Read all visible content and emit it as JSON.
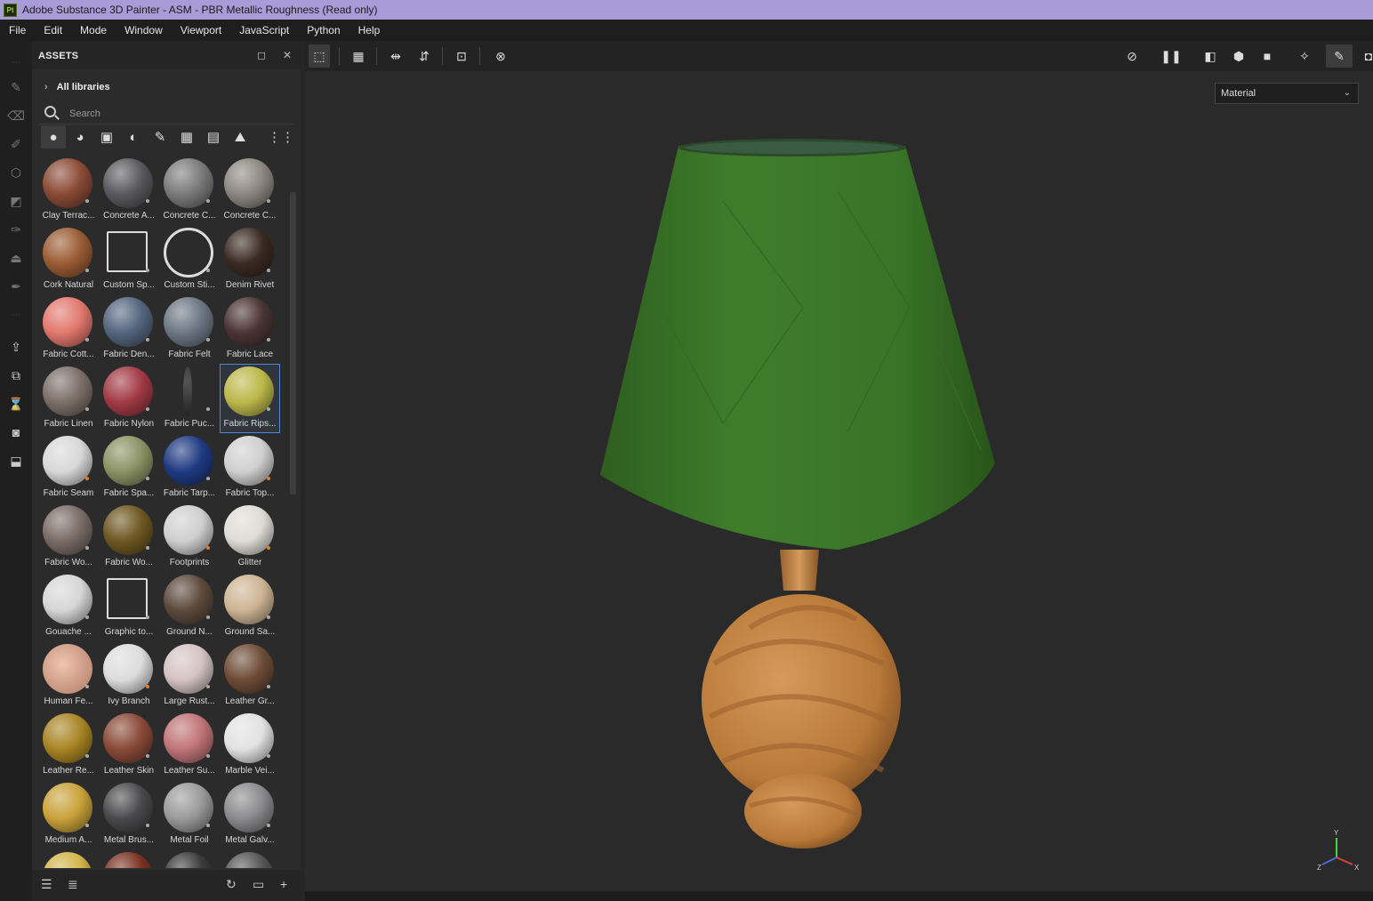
{
  "window": {
    "title": "Adobe Substance 3D Painter - ASM - PBR Metallic Roughness (Read only)",
    "app_icon": "Pt"
  },
  "menu": [
    "File",
    "Edit",
    "Mode",
    "Window",
    "Viewport",
    "JavaScript",
    "Python",
    "Help"
  ],
  "assets": {
    "title": "ASSETS",
    "libraries_label": "All libraries",
    "search_placeholder": "Search",
    "items": [
      {
        "label": "Clay Terrac...",
        "color": "#8a4a36"
      },
      {
        "label": "Concrete A...",
        "color": "#5a5a5e"
      },
      {
        "label": "Concrete C...",
        "color": "#7a7a7a"
      },
      {
        "label": "Concrete C...",
        "color": "#8c8780"
      },
      {
        "label": "Cork Natural",
        "color": "#9a5c34"
      },
      {
        "label": "Custom Sp...",
        "color": "icon"
      },
      {
        "label": "Custom Sti...",
        "color": "icon-face"
      },
      {
        "label": "Denim Rivet",
        "color": "#3a2a22"
      },
      {
        "label": "Fabric Cott...",
        "color": "#e2786e"
      },
      {
        "label": "Fabric Den...",
        "color": "#55657e"
      },
      {
        "label": "Fabric Felt",
        "color": "#6c7784"
      },
      {
        "label": "Fabric Lace",
        "color": "#4a3434"
      },
      {
        "label": "Fabric Linen",
        "color": "#7c6f68"
      },
      {
        "label": "Fabric Nylon",
        "color": "#a23a44"
      },
      {
        "label": "Fabric Puc...",
        "color": "thin"
      },
      {
        "label": "Fabric Rips...",
        "color": "#bcb84a"
      },
      {
        "label": "Fabric Seam",
        "color": "#d8d8d8"
      },
      {
        "label": "Fabric Spa...",
        "color": "#8b9264"
      },
      {
        "label": "Fabric Tarp...",
        "color": "#1f3a82"
      },
      {
        "label": "Fabric Top...",
        "color": "#cfcfcf"
      },
      {
        "label": "Fabric Wo...",
        "color": "#7a6c66"
      },
      {
        "label": "Fabric Wo...",
        "color": "#6e5722"
      },
      {
        "label": "Footprints",
        "color": "#cfcfcf"
      },
      {
        "label": "Glitter",
        "color": "#dedcd6"
      },
      {
        "label": "Gouache ...",
        "color": "#d6d6d6"
      },
      {
        "label": "Graphic to...",
        "color": "icon-graphic"
      },
      {
        "label": "Ground N...",
        "color": "#5c4a3c"
      },
      {
        "label": "Ground Sa...",
        "color": "#cdb494"
      },
      {
        "label": "Human Fe...",
        "color": "face"
      },
      {
        "label": "Ivy Branch",
        "color": "#dcdcdc"
      },
      {
        "label": "Large Rust...",
        "color": "#d5c3c3"
      },
      {
        "label": "Leather Gr...",
        "color": "#6e4c36"
      },
      {
        "label": "Leather Re...",
        "color": "#a88424"
      },
      {
        "label": "Leather Skin",
        "color": "#8a4a38"
      },
      {
        "label": "Leather Su...",
        "color": "#c07478"
      },
      {
        "label": "Marble Vei...",
        "color": "#e2e2e2"
      },
      {
        "label": "Medium A...",
        "color": "#c9a23a"
      },
      {
        "label": "Metal Brus...",
        "color": "#4a4a4c"
      },
      {
        "label": "Metal Foil",
        "color": "#9a9a9a"
      },
      {
        "label": "Metal Galv...",
        "color": "#8a8a8c"
      },
      {
        "label": "",
        "color": "#d2b44a"
      },
      {
        "label": "",
        "color": "#7a3222"
      },
      {
        "label": "",
        "color": "#3a3a3a"
      },
      {
        "label": "",
        "color": "#555555"
      }
    ]
  },
  "viewport": {
    "channel_select": "Material",
    "axis_labels": {
      "y": "Y",
      "z": "Z",
      "x": "X"
    },
    "colors": {
      "shade": "#3e7a2a",
      "shade_dark": "#2c5a1e",
      "wood": "#c8874a",
      "wood_dark": "#8a5428"
    }
  }
}
